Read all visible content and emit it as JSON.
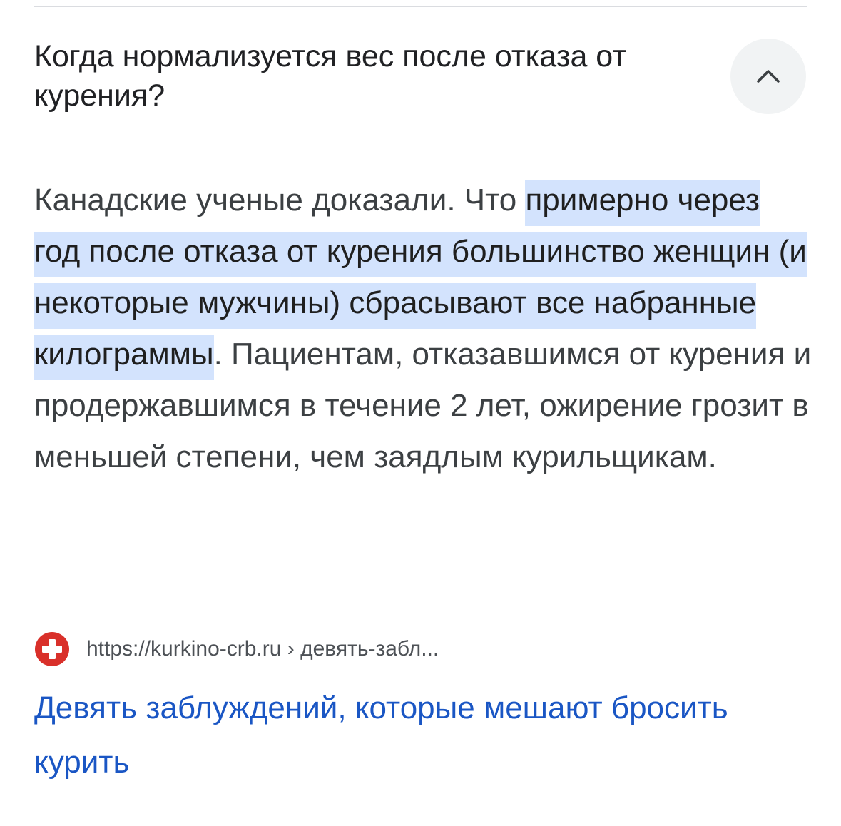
{
  "question": {
    "title": "Когда нормализуется вес после отказа от курения?"
  },
  "collapse_button": {
    "icon": "chevron-up-icon"
  },
  "answer": {
    "lead": "Канадские ученые доказали. Что ",
    "highlighted": "примерно через год после отказа от курения большинство женщин (и некоторые мужчины) сбрасывают все набранные килограммы",
    "tail": ". Пациентам, отказавшимся от курения и продержавшимся в течение 2 лет, ожирение грозит в меньшей степени, чем заядлым курильщикам.",
    "highlight_color": "#d3e3fd"
  },
  "source": {
    "favicon": "red-cross-icon",
    "url_text": "https://kurkino-crb.ru › девять-забл..."
  },
  "result_link": {
    "title": "Девять заблуждений, которые мешают бросить курить",
    "color": "#1a56c4"
  }
}
